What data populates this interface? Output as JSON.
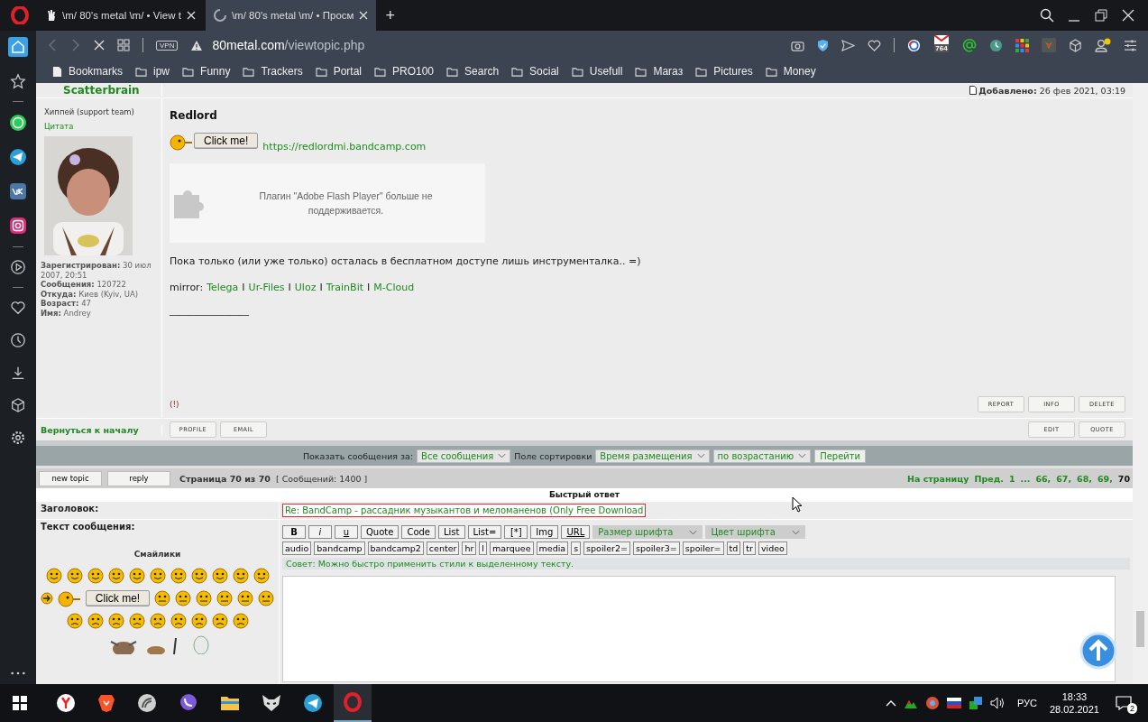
{
  "browser": {
    "tabs": [
      {
        "title": "\\m/ 80's metal \\m/ • View t",
        "selected": false
      },
      {
        "title": "\\m/ 80's metal \\m/ • Просм",
        "selected": true
      }
    ],
    "new_tab": "+",
    "vpn": "VPN",
    "url_domain": "80metal.com",
    "url_path": "/viewtopic.php",
    "mail_badge": "764",
    "bookmarks": [
      {
        "label": "Bookmarks",
        "kind": "page"
      },
      {
        "label": "ipw",
        "kind": "folder"
      },
      {
        "label": "Funny",
        "kind": "folder"
      },
      {
        "label": "Trackers",
        "kind": "folder"
      },
      {
        "label": "Portal",
        "kind": "folder"
      },
      {
        "label": "PRO100",
        "kind": "folder"
      },
      {
        "label": "Search",
        "kind": "folder"
      },
      {
        "label": "Social",
        "kind": "folder"
      },
      {
        "label": "Usefull",
        "kind": "folder"
      },
      {
        "label": "Maraз",
        "kind": "folder"
      },
      {
        "label": "Pictures",
        "kind": "folder"
      },
      {
        "label": "Money",
        "kind": "folder"
      }
    ]
  },
  "post": {
    "author": "Scatterbrain",
    "date_label": "Добавлено:",
    "date": "26 фев 2021, 03:19",
    "rank": "Хиппей (support team)",
    "quote_link": "Цитата",
    "profile": [
      {
        "label": "Зарегистрирован:",
        "value": "30 июл 2007, 20:51"
      },
      {
        "label": "Сообщения:",
        "value": "120722"
      },
      {
        "label": "Откуда:",
        "value": "Киев (Kyiv, UA)"
      },
      {
        "label": "Возраст:",
        "value": "47"
      },
      {
        "label": "Имя:",
        "value": "Andrey"
      }
    ],
    "title": "Redlord",
    "click_button": "Click me!",
    "link": "https://redlordmi.bandcamp.com",
    "flash_notice": "Плагин \"Adobe Flash Player\" больше не поддерживается.",
    "text": "Пока только (или уже только) осталась в бесплатном доступе лишь инструменталка.. =)",
    "mirror_label": "mirror:",
    "mirrors": [
      {
        "label": "Telega"
      },
      {
        "separator": "I",
        "label": "Ur-Files"
      },
      {
        "separator": "I",
        "label": "Uloz"
      },
      {
        "separator": "I",
        "label": "TrainBit"
      },
      {
        "separator": "I",
        "label": "M-Cloud"
      }
    ],
    "signature": "________________",
    "report_mark": "(!)",
    "actions": [
      "REPORT",
      "INFO",
      "DELETE"
    ],
    "back_link": "Вернуться к началу",
    "user_buttons": [
      "PROFILE",
      "EMAIL"
    ],
    "edit_buttons": [
      "EDIT",
      "QUOTE"
    ]
  },
  "sort_bar": {
    "show_label": "Показать сообщения за:",
    "show_value": "Все сообщения",
    "sort_label": "Поле сортировки",
    "sort_value": "Время размещения",
    "order_value": "по возрастанию",
    "go": "Перейти"
  },
  "pagination": {
    "buttons": [
      "new topic",
      "reply"
    ],
    "page_info": "Страница 70 из 70",
    "count": "[ Сообщений: 1400 ]",
    "goto_label": "На страницу",
    "prev": "Пред.",
    "pages": [
      {
        "label": "1",
        "selected": false
      },
      {
        "label": "...",
        "selected": false
      },
      {
        "label": "66,",
        "selected": false
      },
      {
        "label": "67,",
        "selected": false
      },
      {
        "label": "68,",
        "selected": false
      },
      {
        "label": "69,",
        "selected": false
      },
      {
        "label": "70",
        "selected": true
      }
    ]
  },
  "quick_reply": {
    "title": "Быстрый ответ",
    "subject_label": "Заголовок:",
    "subject": "Re: BandCamp - рассадник музыкантов и меломаненов (Only Free Download",
    "text_label": "Текст сообщения:",
    "smileys_title": "Смайлики",
    "smiley_button": "Click me!",
    "format_buttons": [
      {
        "label": "B",
        "kind": "bold"
      },
      {
        "label": "i",
        "kind": "italic"
      },
      {
        "label": "u",
        "kind": "underline"
      },
      {
        "label": "Quote",
        "kind": "plain"
      },
      {
        "label": "Code",
        "kind": "plain"
      },
      {
        "label": "List",
        "kind": "plain"
      },
      {
        "label": "List=",
        "kind": "plain"
      },
      {
        "label": "[*]",
        "kind": "plain"
      },
      {
        "label": "Img",
        "kind": "plain"
      },
      {
        "label": "URL",
        "kind": "underline"
      }
    ],
    "font_size": "Размер шрифта",
    "font_color": "Цвет шрифта",
    "tags": [
      "audio",
      "bandcamp",
      "bandcamp2",
      "center",
      "hr",
      "l",
      "marquee",
      "media",
      "s",
      "spoiler2=",
      "spoiler3=",
      "spoiler=",
      "td",
      "tr",
      "video"
    ],
    "tip": "Совет: Можно быстро применить стили к выделенному тексту."
  },
  "taskbar": {
    "language": "РУС",
    "time": "18:33",
    "date": "28.02.2021",
    "notifications": "2"
  }
}
